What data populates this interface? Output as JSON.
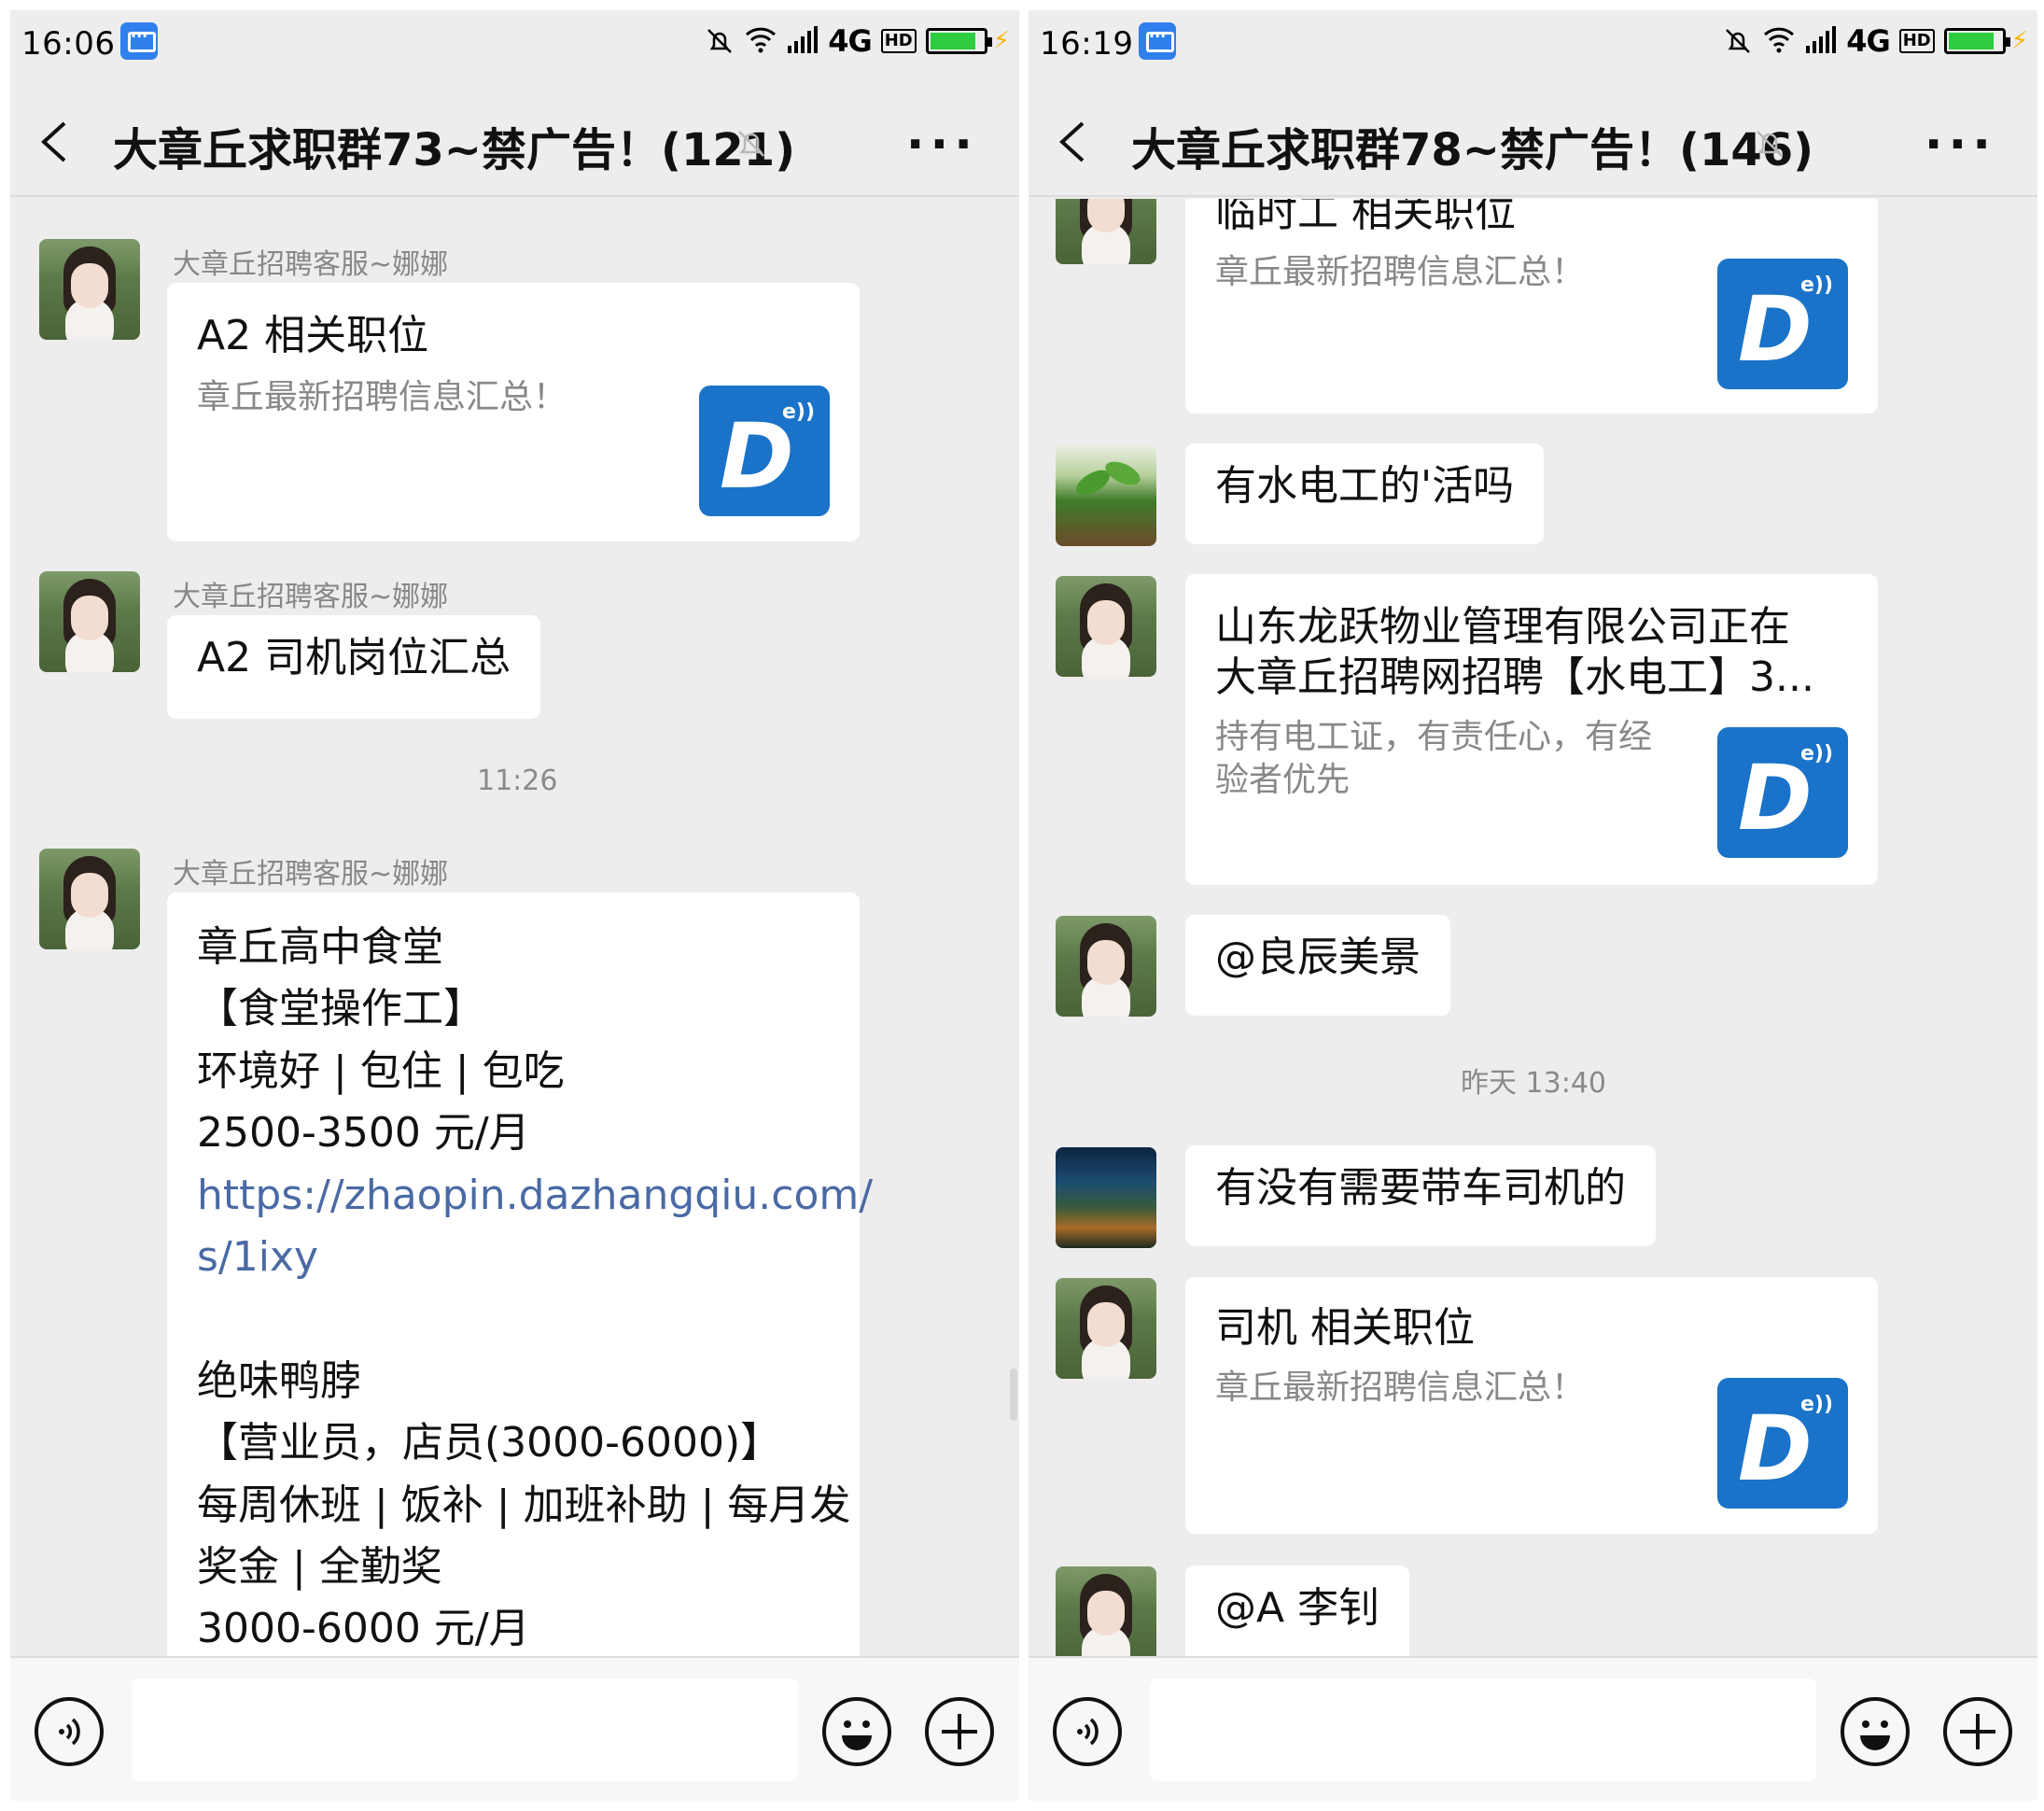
{
  "left": {
    "status": {
      "time": "16:06",
      "network": "4G",
      "hd": "HD"
    },
    "title": "大章丘求职群73~禁广告！(121)",
    "messages": {
      "m1": {
        "sender": "大章丘招聘客服~娜娜",
        "card_title": "A2 相关职位",
        "card_desc": "章丘最新招聘信息汇总！"
      },
      "m2": {
        "sender": "大章丘招聘客服~娜娜",
        "text": "A2 司机岗位汇总"
      },
      "time1": "11:26",
      "m3": {
        "sender": "大章丘招聘客服~娜娜",
        "lines": [
          "章丘高中食堂",
          "【食堂操作工】",
          "环境好 | 包住 | 包吃",
          "2500-3500 元/月",
          "https://zhaopin.dazhangqiu.com/",
          "s/1ixy",
          "",
          "绝味鸭脖",
          "【营业员，店员(3000-6000)】",
          "每周休班 | 饭补 | 加班补助 | 每月发",
          "奖金 | 全勤奖",
          "3000-6000 元/月"
        ]
      }
    }
  },
  "right": {
    "status": {
      "time": "16:19",
      "network": "4G",
      "hd": "HD"
    },
    "title": "大章丘求职群78~禁广告！(146)",
    "messages": {
      "r1": {
        "card_title": "临时工 相关职位",
        "card_desc": "章丘最新招聘信息汇总！"
      },
      "r2": {
        "text": "有水电工的'活吗"
      },
      "r3": {
        "card_title_1": "山东龙跃物业管理有限公司正在",
        "card_title_2": "大章丘招聘网招聘【水电工】3...",
        "card_desc_1": "持有电工证，有责任心，有经",
        "card_desc_2": "验者优先"
      },
      "r4": {
        "text": "@良辰美景"
      },
      "time1": "昨天 13:40",
      "r5": {
        "text": "有没有需要带车司机的"
      },
      "r6": {
        "card_title": "司机 相关职位",
        "card_desc": "章丘最新招聘信息汇总！"
      },
      "r7": {
        "text": "@A 李钊"
      }
    }
  },
  "logo": {
    "letter": "D",
    "mark": "e))"
  },
  "icons": {
    "back": "chevron-left-icon",
    "mute": "bell-off-icon",
    "more": "more-icon",
    "voice": "voice-icon",
    "emoji": "emoji-icon",
    "plus": "plus-icon"
  },
  "colors": {
    "background": "#ededed",
    "link": "#4a6aa5",
    "logo": "#1a73c8"
  }
}
